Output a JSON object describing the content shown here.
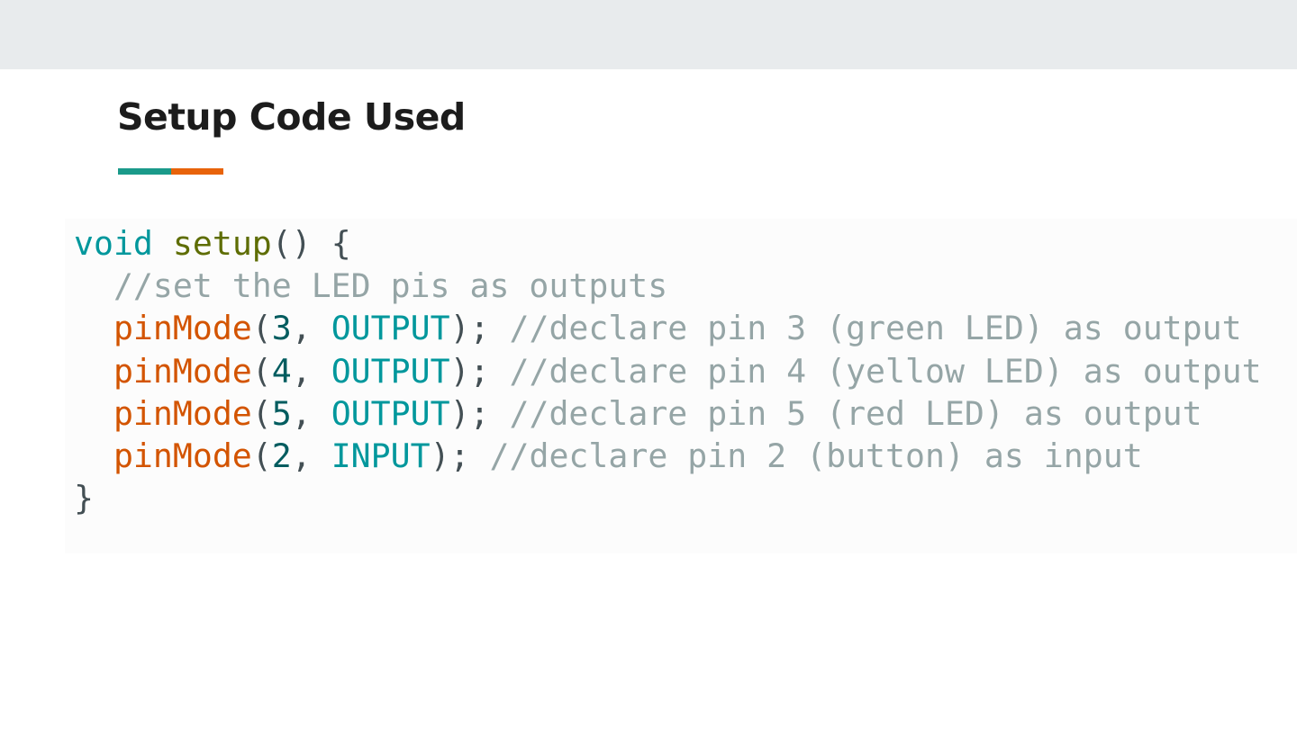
{
  "slide": {
    "title": "Setup Code Used",
    "colors": {
      "top_band": "#e8ebed",
      "accent_teal": "#1a9a8a",
      "accent_orange": "#e8630a",
      "title_text": "#1c1c1c"
    }
  },
  "code": {
    "language": "arduino",
    "lines": [
      {
        "tokens": [
          {
            "text": "void",
            "kind": "kw"
          },
          {
            "text": " ",
            "kind": "punc"
          },
          {
            "text": "setup",
            "kind": "fn"
          },
          {
            "text": "() {",
            "kind": "punc"
          }
        ]
      },
      {
        "tokens": [
          {
            "text": "  //set the LED pis as outputs",
            "kind": "cmt"
          }
        ]
      },
      {
        "tokens": [
          {
            "text": "  ",
            "kind": "punc"
          },
          {
            "text": "pinMode",
            "kind": "fn2"
          },
          {
            "text": "(",
            "kind": "punc"
          },
          {
            "text": "3",
            "kind": "num"
          },
          {
            "text": ", ",
            "kind": "punc"
          },
          {
            "text": "OUTPUT",
            "kind": "const"
          },
          {
            "text": "); ",
            "kind": "punc"
          },
          {
            "text": "//declare pin 3 (green LED) as output",
            "kind": "cmt"
          }
        ]
      },
      {
        "tokens": [
          {
            "text": "  ",
            "kind": "punc"
          },
          {
            "text": "pinMode",
            "kind": "fn2"
          },
          {
            "text": "(",
            "kind": "punc"
          },
          {
            "text": "4",
            "kind": "num"
          },
          {
            "text": ", ",
            "kind": "punc"
          },
          {
            "text": "OUTPUT",
            "kind": "const"
          },
          {
            "text": "); ",
            "kind": "punc"
          },
          {
            "text": "//declare pin 4 (yellow LED) as output",
            "kind": "cmt"
          }
        ]
      },
      {
        "tokens": [
          {
            "text": "  ",
            "kind": "punc"
          },
          {
            "text": "pinMode",
            "kind": "fn2"
          },
          {
            "text": "(",
            "kind": "punc"
          },
          {
            "text": "5",
            "kind": "num"
          },
          {
            "text": ", ",
            "kind": "punc"
          },
          {
            "text": "OUTPUT",
            "kind": "const"
          },
          {
            "text": "); ",
            "kind": "punc"
          },
          {
            "text": "//declare pin 5 (red LED) as output",
            "kind": "cmt"
          }
        ]
      },
      {
        "tokens": [
          {
            "text": "  ",
            "kind": "punc"
          },
          {
            "text": "pinMode",
            "kind": "fn2"
          },
          {
            "text": "(",
            "kind": "punc"
          },
          {
            "text": "2",
            "kind": "num"
          },
          {
            "text": ", ",
            "kind": "punc"
          },
          {
            "text": "INPUT",
            "kind": "const"
          },
          {
            "text": "); ",
            "kind": "punc"
          },
          {
            "text": "//declare pin 2 (button) as input",
            "kind": "cmt"
          }
        ]
      },
      {
        "tokens": [
          {
            "text": "}",
            "kind": "punc"
          }
        ]
      }
    ]
  }
}
